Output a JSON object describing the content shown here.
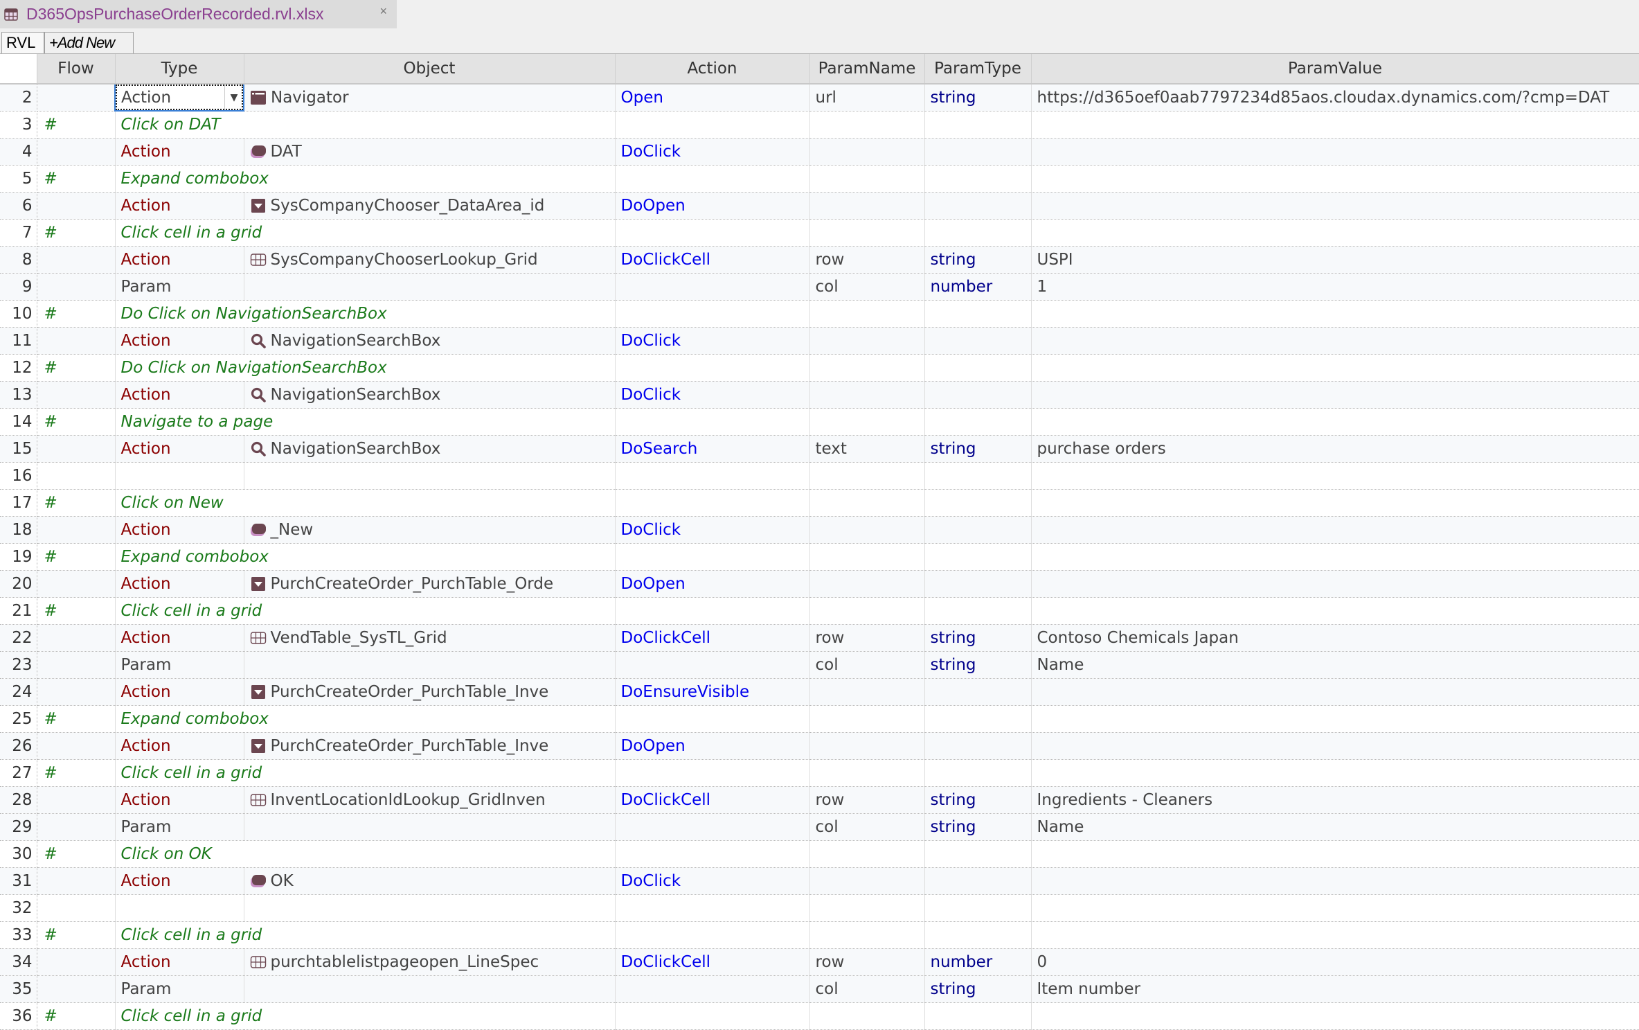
{
  "document_tab": {
    "title": "D365OpsPurchaseOrderRecorded.rvl.xlsx",
    "close_label": "×",
    "icon": "spreadsheet-icon"
  },
  "sheet_tabs": [
    {
      "label": "RVL",
      "active": true
    },
    {
      "label": "+Add New",
      "active": false
    }
  ],
  "columns": [
    "",
    "Flow",
    "Type",
    "Object",
    "Action",
    "ParamName",
    "ParamType",
    "ParamValue"
  ],
  "rows": [
    {
      "num": "2",
      "kind": "action",
      "flow": "",
      "type": "Action",
      "icon": "window",
      "object": "Navigator",
      "action": "Open",
      "param_name": "url",
      "param_type": "string",
      "param_value": "https://d365oef0aab7797234d85aos.cloudax.dynamics.com/?cmp=DAT",
      "selected": true
    },
    {
      "num": "3",
      "kind": "comment",
      "flow": "#",
      "comment": "Click on DAT"
    },
    {
      "num": "4",
      "kind": "action",
      "flow": "",
      "type": "Action",
      "icon": "button",
      "object": "DAT",
      "action": "DoClick",
      "param_name": "",
      "param_type": "",
      "param_value": ""
    },
    {
      "num": "5",
      "kind": "comment",
      "flow": "#",
      "comment": "Expand combobox"
    },
    {
      "num": "6",
      "kind": "action",
      "flow": "",
      "type": "Action",
      "icon": "combobox",
      "object": "SysCompanyChooser_DataArea_id",
      "action": "DoOpen",
      "param_name": "",
      "param_type": "",
      "param_value": ""
    },
    {
      "num": "7",
      "kind": "comment",
      "flow": "#",
      "comment": "Click cell in a grid"
    },
    {
      "num": "8",
      "kind": "action",
      "flow": "",
      "type": "Action",
      "icon": "grid",
      "object": "SysCompanyChooserLookup_Grid",
      "action": "DoClickCell",
      "param_name": "row",
      "param_type": "string",
      "param_value": "USPI"
    },
    {
      "num": "9",
      "kind": "param",
      "flow": "",
      "type": "Param",
      "icon": "",
      "object": "",
      "action": "",
      "param_name": "col",
      "param_type": "number",
      "param_value": "1"
    },
    {
      "num": "10",
      "kind": "comment",
      "flow": "#",
      "comment": "Do Click on NavigationSearchBox"
    },
    {
      "num": "11",
      "kind": "action",
      "flow": "",
      "type": "Action",
      "icon": "search",
      "object": "NavigationSearchBox",
      "action": "DoClick",
      "param_name": "",
      "param_type": "",
      "param_value": ""
    },
    {
      "num": "12",
      "kind": "comment",
      "flow": "#",
      "comment": "Do Click on NavigationSearchBox"
    },
    {
      "num": "13",
      "kind": "action",
      "flow": "",
      "type": "Action",
      "icon": "search",
      "object": "NavigationSearchBox",
      "action": "DoClick",
      "param_name": "",
      "param_type": "",
      "param_value": ""
    },
    {
      "num": "14",
      "kind": "comment",
      "flow": "#",
      "comment": "Navigate to a page"
    },
    {
      "num": "15",
      "kind": "action",
      "flow": "",
      "type": "Action",
      "icon": "search",
      "object": "NavigationSearchBox",
      "action": "DoSearch",
      "param_name": "text",
      "param_type": "string",
      "param_value": "purchase orders"
    },
    {
      "num": "16",
      "kind": "blank"
    },
    {
      "num": "17",
      "kind": "comment",
      "flow": "#",
      "comment": "Click on New"
    },
    {
      "num": "18",
      "kind": "action",
      "flow": "",
      "type": "Action",
      "icon": "button",
      "object": "_New",
      "action": "DoClick",
      "param_name": "",
      "param_type": "",
      "param_value": ""
    },
    {
      "num": "19",
      "kind": "comment",
      "flow": "#",
      "comment": "Expand combobox"
    },
    {
      "num": "20",
      "kind": "action",
      "flow": "",
      "type": "Action",
      "icon": "combobox",
      "object": "PurchCreateOrder_PurchTable_Orde",
      "action": "DoOpen",
      "param_name": "",
      "param_type": "",
      "param_value": ""
    },
    {
      "num": "21",
      "kind": "comment",
      "flow": "#",
      "comment": "Click cell in a grid"
    },
    {
      "num": "22",
      "kind": "action",
      "flow": "",
      "type": "Action",
      "icon": "grid",
      "object": "VendTable_SysTL_Grid",
      "action": "DoClickCell",
      "param_name": "row",
      "param_type": "string",
      "param_value": "Contoso Chemicals Japan"
    },
    {
      "num": "23",
      "kind": "param",
      "flow": "",
      "type": "Param",
      "icon": "",
      "object": "",
      "action": "",
      "param_name": "col",
      "param_type": "string",
      "param_value": "Name"
    },
    {
      "num": "24",
      "kind": "action",
      "flow": "",
      "type": "Action",
      "icon": "combobox",
      "object": "PurchCreateOrder_PurchTable_Inve",
      "action": "DoEnsureVisible",
      "param_name": "",
      "param_type": "",
      "param_value": ""
    },
    {
      "num": "25",
      "kind": "comment",
      "flow": "#",
      "comment": "Expand combobox"
    },
    {
      "num": "26",
      "kind": "action",
      "flow": "",
      "type": "Action",
      "icon": "combobox",
      "object": "PurchCreateOrder_PurchTable_Inve",
      "action": "DoOpen",
      "param_name": "",
      "param_type": "",
      "param_value": ""
    },
    {
      "num": "27",
      "kind": "comment",
      "flow": "#",
      "comment": "Click cell in a grid"
    },
    {
      "num": "28",
      "kind": "action",
      "flow": "",
      "type": "Action",
      "icon": "grid",
      "object": "InventLocationIdLookup_GridInven",
      "action": "DoClickCell",
      "param_name": "row",
      "param_type": "string",
      "param_value": "Ingredients - Cleaners"
    },
    {
      "num": "29",
      "kind": "param",
      "flow": "",
      "type": "Param",
      "icon": "",
      "object": "",
      "action": "",
      "param_name": "col",
      "param_type": "string",
      "param_value": "Name"
    },
    {
      "num": "30",
      "kind": "comment",
      "flow": "#",
      "comment": "Click on OK"
    },
    {
      "num": "31",
      "kind": "action",
      "flow": "",
      "type": "Action",
      "icon": "button",
      "object": "OK",
      "action": "DoClick",
      "param_name": "",
      "param_type": "",
      "param_value": ""
    },
    {
      "num": "32",
      "kind": "blank"
    },
    {
      "num": "33",
      "kind": "comment",
      "flow": "#",
      "comment": "Click cell in a grid"
    },
    {
      "num": "34",
      "kind": "action",
      "flow": "",
      "type": "Action",
      "icon": "grid",
      "object": "purchtablelistpageopen_LineSpec",
      "action": "DoClickCell",
      "param_name": "row",
      "param_type": "number",
      "param_value": "0"
    },
    {
      "num": "35",
      "kind": "param",
      "flow": "",
      "type": "Param",
      "icon": "",
      "object": "",
      "action": "",
      "param_name": "col",
      "param_type": "string",
      "param_value": "Item number"
    },
    {
      "num": "36",
      "kind": "comment",
      "flow": "#",
      "comment": "Click cell in a grid"
    }
  ],
  "colors": {
    "tab_title": "#8a3f8f",
    "icon_fill": "#6b4650",
    "icon_accent": "#c98fc4",
    "comment_text": "#1a7a1a",
    "type_action_text": "#8b0000",
    "action_text": "#0000ee",
    "param_type_text": "#00008b"
  }
}
